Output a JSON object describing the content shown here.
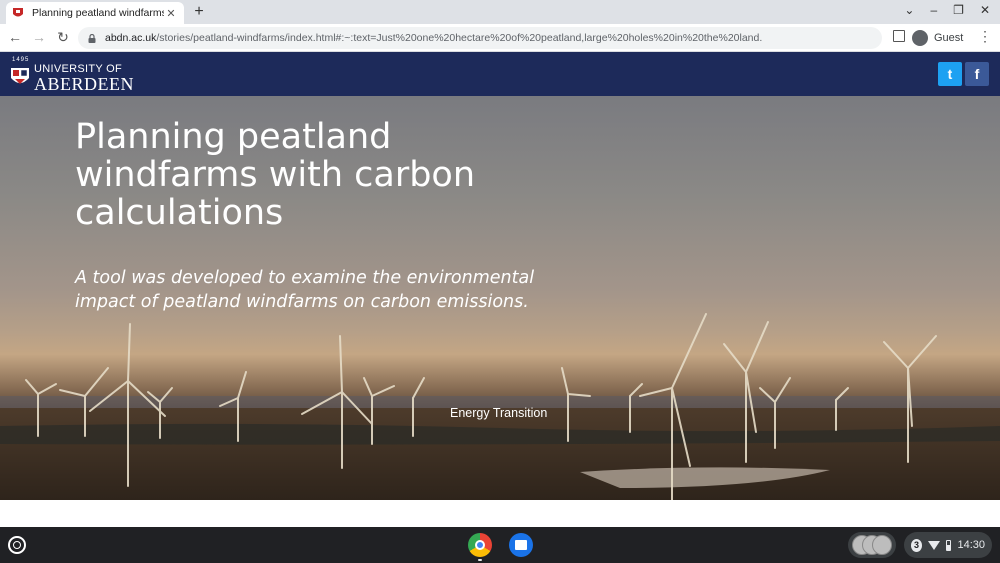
{
  "browser": {
    "tab_title": "Planning peatland windfarms w",
    "tab_close": "✕",
    "new_tab": "+",
    "window_controls": [
      "⌄",
      "–",
      "❐",
      "✕"
    ],
    "back": "←",
    "forward": "→",
    "reload": "↻",
    "url_host": "abdn.ac.uk",
    "url_path": "/stories/peatland-windfarms/index.html#:~:text=Just%20one%20hectare%20of%20peatland,large%20holes%20in%20the%20land.",
    "profile_label": "Guest",
    "menu": "⋮"
  },
  "site": {
    "logo_year": "1495",
    "logo_line1": "UNIVERSITY OF",
    "logo_line2": "ABERDEEN",
    "twitter_glyph": "t",
    "facebook_glyph": "f",
    "brand_color": "#1d2a5a",
    "twitter_color": "#1da1f2",
    "facebook_color": "#3b5998"
  },
  "hero": {
    "title": "Planning peatland windfarms with carbon calculations",
    "subtitle": "A tool was developed to examine the environmental impact of peatland windfarms on carbon emissions.",
    "tag": "Energy Transition"
  },
  "shelf": {
    "notification_count": "3",
    "time": "14:30"
  }
}
